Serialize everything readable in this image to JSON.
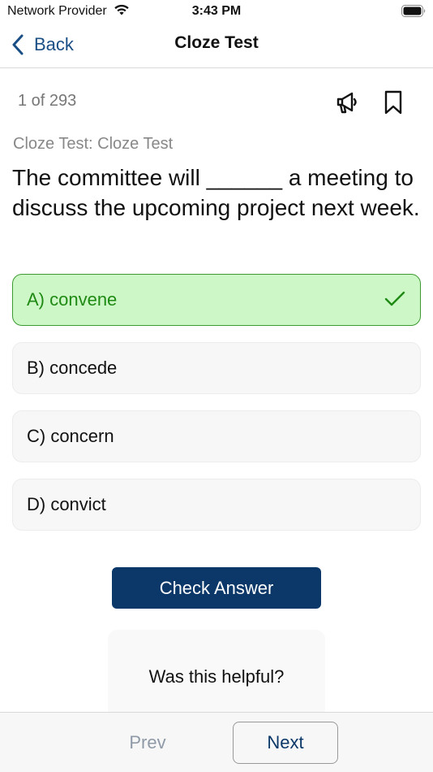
{
  "status_bar": {
    "carrier": "Network Provider",
    "time": "3:43 PM",
    "wifi_icon": "wifi-icon",
    "battery_icon": "battery-icon"
  },
  "nav": {
    "back_label": "Back",
    "title": "Cloze Test"
  },
  "question": {
    "counter": "1 of 293",
    "category": "Cloze Test: Cloze Test",
    "text": "The committee will ______ a meeting to discuss the upcoming project next week.",
    "icons": [
      "megaphone-icon",
      "bookmark-icon"
    ]
  },
  "options": [
    {
      "label": "A) convene",
      "state": "selected-correct"
    },
    {
      "label": "B) concede",
      "state": "default"
    },
    {
      "label": "C) concern",
      "state": "default"
    },
    {
      "label": "D) convict",
      "state": "default"
    }
  ],
  "actions": {
    "check_answer": "Check Answer"
  },
  "feedback": {
    "prompt": "Was this helpful?"
  },
  "bottom": {
    "prev": "Prev",
    "next": "Next"
  },
  "colors": {
    "brand": "#0b3869",
    "link": "#1a4f86",
    "correct_bg": "#cdf7c6",
    "correct_text": "#1f8a14",
    "disabled": "#8f9aa8"
  }
}
